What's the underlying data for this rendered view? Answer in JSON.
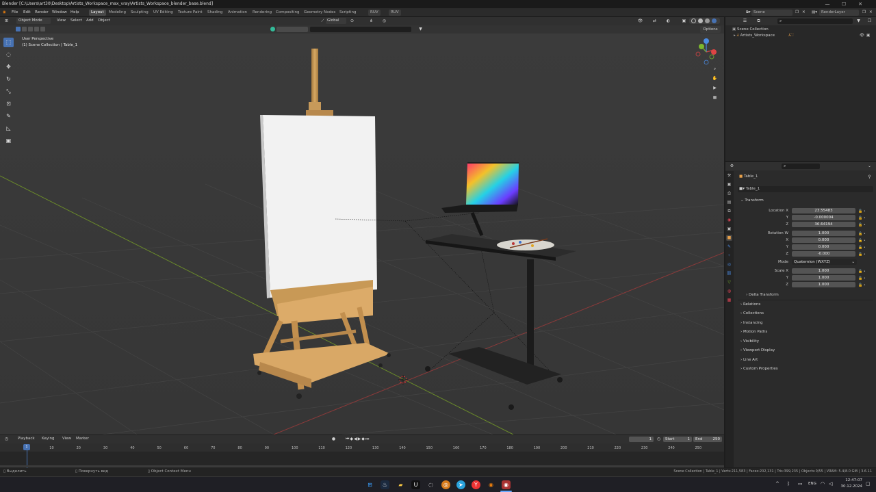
{
  "window": {
    "title": "Blender [C:\\Users\\art30\\Desktop\\Artists_Workspace_max_vray\\Artists_Workspace_blender_base.blend]",
    "controls": [
      "—",
      "☐",
      "✕"
    ]
  },
  "menu": {
    "items": [
      "File",
      "Edit",
      "Render",
      "Window",
      "Help"
    ],
    "workspaces": [
      "Layout",
      "Modeling",
      "Sculpting",
      "UV Editing",
      "Texture Paint",
      "Shading",
      "Animation",
      "Rendering",
      "Compositing",
      "Geometry Nodes",
      "Scripting"
    ],
    "active_workspace": "Layout",
    "addon_buttons": [
      "RUV",
      "RUV"
    ],
    "scene_label": "Scene",
    "render_layer_label": "RenderLayer"
  },
  "viewport": {
    "mode": "Object Mode",
    "menus": [
      "View",
      "Select",
      "Add",
      "Object"
    ],
    "orientation": "Global",
    "options_label": "Options",
    "overlay_title": "User Perspective",
    "overlay_subtitle": "(1) Scene Collection | Table_1",
    "tools": [
      "select-box",
      "cursor",
      "move",
      "rotate",
      "scale",
      "transform",
      "annotate",
      "measure",
      "add-cube"
    ],
    "gizmo_axes": [
      "X",
      "Y",
      "Z"
    ]
  },
  "outliner": {
    "root": "Scene Collection",
    "items": [
      {
        "label": "Artists_Workspace"
      }
    ]
  },
  "properties": {
    "object_name": "Table_1",
    "data_name": "Table_1",
    "section": "Transform",
    "location": {
      "label": "Location",
      "x": "23.55483",
      "y": "-0.000004",
      "z": "36.64194"
    },
    "rotation": {
      "label": "Rotation",
      "w": "1.000",
      "x": "0.000",
      "y": "0.000",
      "z": "-0.000"
    },
    "mode": {
      "label": "Mode",
      "value": "Quaternion (WXYZ)"
    },
    "scale": {
      "label": "Scale",
      "x": "1.000",
      "y": "1.000",
      "z": "1.000"
    },
    "axis_labels": {
      "x": "X",
      "y": "Y",
      "z": "Z",
      "w": "W"
    },
    "sub_panel": "Delta Transform",
    "panels": [
      "Relations",
      "Collections",
      "Instancing",
      "Motion Paths",
      "Visibility",
      "Viewport Display",
      "Line Art",
      "Custom Properties"
    ]
  },
  "timeline": {
    "menus": [
      "Playback",
      "Keying",
      "View",
      "Marker"
    ],
    "current_frame": "1",
    "start_label": "Start",
    "start": "1",
    "end_label": "End",
    "end": "250",
    "playhead": "1",
    "ticks": [
      "10",
      "20",
      "30",
      "40",
      "50",
      "60",
      "70",
      "80",
      "90",
      "100",
      "110",
      "120",
      "130",
      "140",
      "150",
      "160",
      "170",
      "180",
      "190",
      "200",
      "210",
      "220",
      "230",
      "240",
      "250"
    ]
  },
  "status": {
    "left": [
      "Выделить",
      "Повернуть вид",
      "Object Context Menu"
    ],
    "right": "Scene Collection | Table_1 | Verts:211,583 | Faces:202,131 | Tris:399,235 | Objects:0/55 | VRAM: 5.4/8.0 GiB | 3.6.11"
  },
  "taskbar": {
    "language": "ENG",
    "time": "12:47:07",
    "date": "30.12.2024"
  },
  "colors": {
    "accent": "#4772b3",
    "viewport_bg": "#3a3a3a",
    "axis_x": "#8a3a3a",
    "axis_y": "#6a8a2a"
  }
}
